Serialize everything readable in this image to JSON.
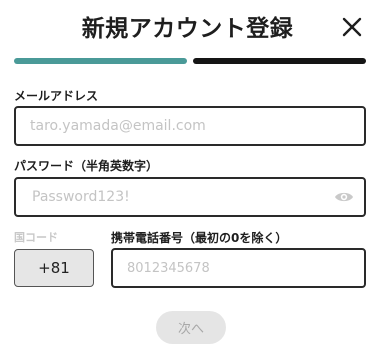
{
  "header": {
    "title": "新規アカウント登録",
    "close_icon": "close-icon"
  },
  "progress": {
    "total_steps": 2,
    "current_step": 1,
    "done_color": "#4a9a98",
    "todo_color": "#151515"
  },
  "email": {
    "label": "メールアドレス",
    "placeholder": "taro.yamada@email.com"
  },
  "password": {
    "label": "パスワード（半角英数字）",
    "placeholder": "Password123!",
    "toggle_icon": "eye-icon"
  },
  "country": {
    "label": "国コード",
    "value": "+81"
  },
  "phone": {
    "label": "携帯電話番号（最初の0を除く）",
    "placeholder": "8012345678"
  },
  "next_button": {
    "label": "次へ"
  }
}
